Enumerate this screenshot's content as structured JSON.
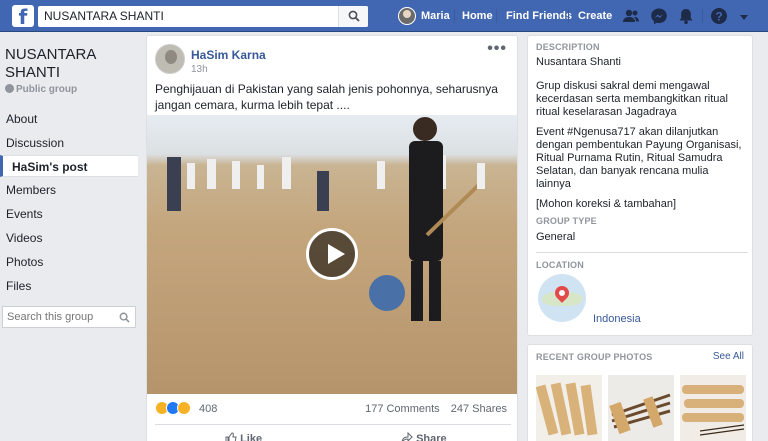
{
  "topbar": {
    "logo": "f",
    "search_value": "NUSANTARA SHANTI",
    "user_name": "Maria",
    "nav_home": "Home",
    "nav_find_friends": "Find Friends",
    "nav_create": "Create",
    "icons": [
      "friends-icon",
      "messenger-icon",
      "notifications-icon",
      "help-icon",
      "account-menu-icon"
    ]
  },
  "sidebar": {
    "group_name": "NUSANTARA SHANTI",
    "privacy": "Public group",
    "items": [
      {
        "label": "About"
      },
      {
        "label": "Discussion"
      },
      {
        "label": "HaSim's post"
      },
      {
        "label": "Members"
      },
      {
        "label": "Events"
      },
      {
        "label": "Videos"
      },
      {
        "label": "Photos"
      },
      {
        "label": "Files"
      }
    ],
    "search_placeholder": "Search this group"
  },
  "post": {
    "author": "HaSim Karna",
    "time": "13h",
    "text": "Penghijauan di Pakistan yang salah jenis pohonnya, seharusnya jangan cemara, kurma lebih tepat ....",
    "reaction_count": "408",
    "comments": "177 Comments",
    "shares": "247 Shares",
    "like_label": "Like",
    "share_label": "Share"
  },
  "about": {
    "description_label": "DESCRIPTION",
    "description_title": "Nusantara Shanti",
    "description_body": "Grup diskusi sakral demi mengawal kecerdasan serta membangkitkan ritual ritual keselarasan Jagadraya",
    "description_event": "Event #Ngenusa717 akan dilanjutkan dengan pembentukan Payung Organisasi, Ritual Purnama Rutin, Ritual Samudra Selatan, dan banyak rencana mulia lainnya",
    "description_note": "[Mohon koreksi & tambahan]",
    "group_type_label": "GROUP TYPE",
    "group_type": "General",
    "location_label": "LOCATION",
    "location": "Indonesia"
  },
  "photos": {
    "label": "RECENT GROUP PHOTOS",
    "see_all": "See All"
  },
  "colors": {
    "brand": "#4267b2",
    "link": "#385898",
    "page_bg": "#e9ebee"
  }
}
